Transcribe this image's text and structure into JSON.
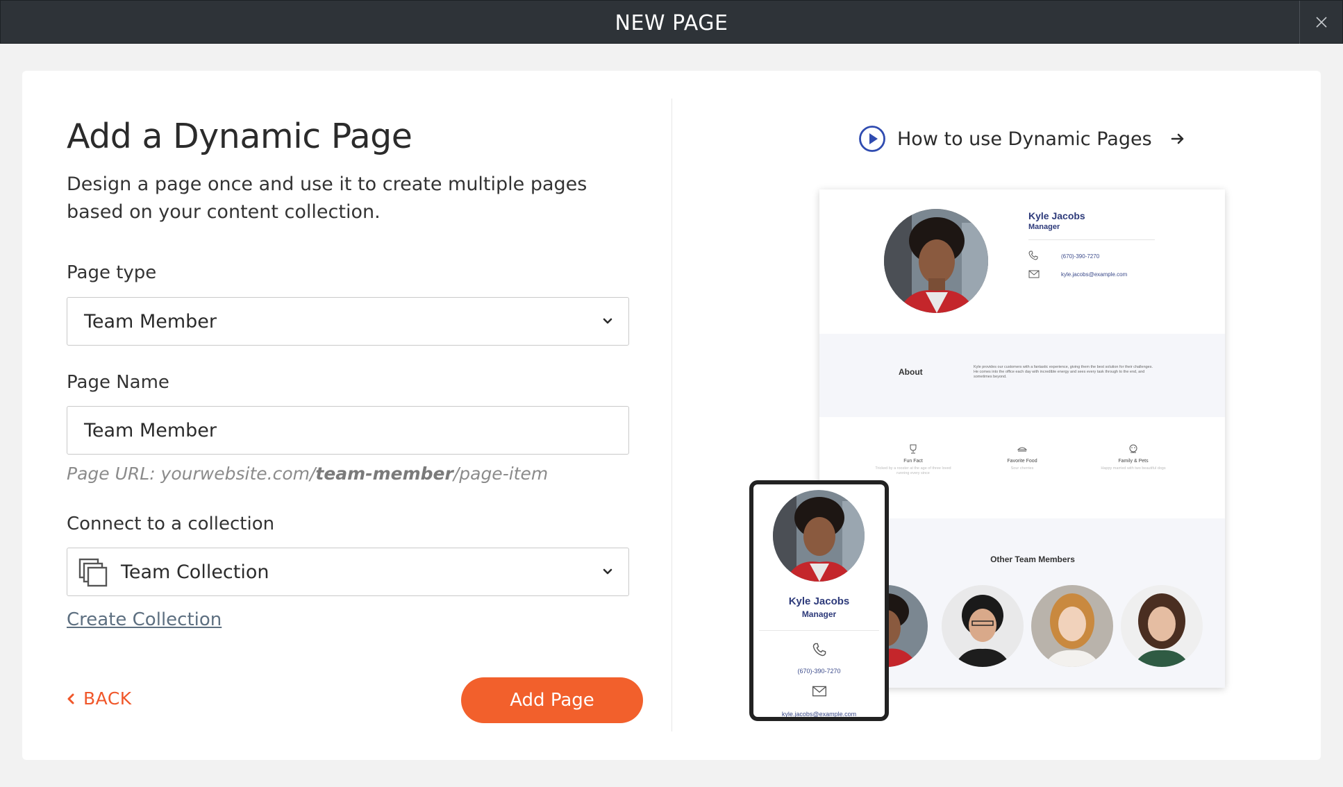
{
  "modal": {
    "title": "NEW PAGE",
    "close_icon": "close-icon"
  },
  "form": {
    "heading": "Add a Dynamic Page",
    "description": "Design a page once and use it to create multiple pages based on your content collection.",
    "page_type": {
      "label": "Page type",
      "value": "Team Member"
    },
    "page_name": {
      "label": "Page Name",
      "value": "Team Member"
    },
    "url_hint": {
      "prefix": "Page URL: yourwebsite.com/",
      "slug": "team-member",
      "suffix": "/page-item"
    },
    "collection": {
      "label": "Connect to a collection",
      "value": "Team Collection"
    },
    "create_collection": "Create Collection",
    "back_label": "BACK",
    "submit_label": "Add Page"
  },
  "help": {
    "link_text": "How to use Dynamic Pages"
  },
  "preview": {
    "name": "Kyle Jacobs",
    "role": "Manager",
    "phone": "(670)-390-7270",
    "email": "kyle.jacobs@example.com",
    "about_title": "About",
    "about_text": "Kyle provides our customers with a fantastic experience, giving them the best solution for their challenges. He comes into the office each day with incredible energy and sees every task through to the end, and sometimes beyond.",
    "facts": [
      {
        "title": "Fun Fact",
        "text": "Tricked by a rooster at the age of three loved running every since"
      },
      {
        "title": "Favorite Food",
        "text": "Sour cherries"
      },
      {
        "title": "Family & Pets",
        "text": "Happy married with two beautiful dogs"
      }
    ],
    "others_title": "Other Team Members"
  },
  "colors": {
    "accent": "#f2602c",
    "topbar": "#2e3338",
    "link": "#5d6f80",
    "preview_navy": "#2d3a7a"
  }
}
